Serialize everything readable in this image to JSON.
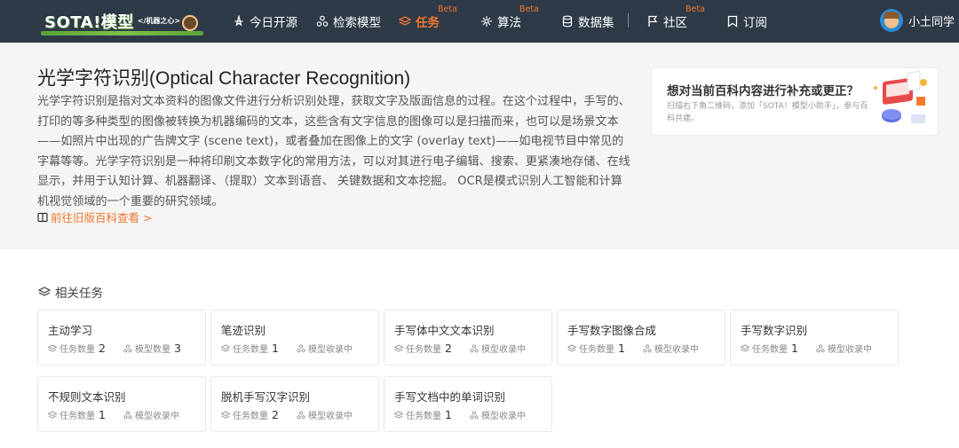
{
  "nav": {
    "logo_text": "SOTA!模型",
    "logo_sub": "</机器之心>",
    "items": [
      {
        "label": "今日开源",
        "icon": "star-icon"
      },
      {
        "label": "检索模型",
        "icon": "model-icon"
      },
      {
        "label": "任务",
        "icon": "layers-icon",
        "badge": "Beta",
        "active": true
      },
      {
        "label": "算法",
        "icon": "algorithm-icon",
        "badge": "Beta"
      },
      {
        "label": "数据集",
        "icon": "database-icon"
      },
      {
        "label": "社区",
        "icon": "flag-icon",
        "badge": "Beta"
      },
      {
        "label": "订阅",
        "icon": "bookmark-icon"
      }
    ],
    "user": "小土同学"
  },
  "hero": {
    "title": "光学字符识别(Optical Character Recognition)",
    "description": "光学字符识别是指对文本资料的图像文件进行分析识别处理，获取文字及版面信息的过程。在这个过程中，手写的、打印的等多种类型的图像被转换为机器编码的文本，这些含有文字信息的图像可以是扫描而来，也可以是场景文本——如照片中出现的广告牌文字 (scene text)，或者叠加在图像上的文字 (overlay text)——如电视节目中常见的字幕等等。光学字符识别是一种将印刷文本数字化的常用方法，可以对其进行电子编辑、搜索、更紧凑地存储、在线显示，并用于认知计算、机器翻译、（提取）文本到语音、 关键数据和文本挖掘。 OCR是模式识别人工智能和计算机视觉领域的一个重要的研究领域。",
    "old_link": "前往旧版百科查看 >"
  },
  "help_card": {
    "title": "想对当前百科内容进行补充或更正？",
    "description": "扫描右下角二维码，添加「SOTA！模型小助手」，参与百科共建。"
  },
  "tasks_section": {
    "title": "相关任务",
    "task_count_label": "任务数量",
    "model_count_label": "模型数量",
    "model_pending_label": "模型收录中",
    "items": [
      {
        "name": "主动学习",
        "task_count": "2",
        "model": "模型数量",
        "model_count": "3"
      },
      {
        "name": "笔迹识别",
        "task_count": "1",
        "model": "模型收录中",
        "model_count": ""
      },
      {
        "name": "手写体中文文本识别",
        "task_count": "2",
        "model": "模型收录中",
        "model_count": ""
      },
      {
        "name": "手写数字图像合成",
        "task_count": "1",
        "model": "模型收录中",
        "model_count": ""
      },
      {
        "name": "手写数字识别",
        "task_count": "1",
        "model": "模型收录中",
        "model_count": ""
      },
      {
        "name": "不规则文本识别",
        "task_count": "1",
        "model": "模型收录中",
        "model_count": ""
      },
      {
        "name": "脱机手写汉字识别",
        "task_count": "2",
        "model": "模型收录中",
        "model_count": ""
      },
      {
        "name": "手写文档中的单词识别",
        "task_count": "1",
        "model": "模型收录中",
        "model_count": ""
      }
    ]
  },
  "colors": {
    "nav_bg": "#2f3a48",
    "accent": "#f0772f",
    "hero_bg": "#f5f5f5"
  }
}
